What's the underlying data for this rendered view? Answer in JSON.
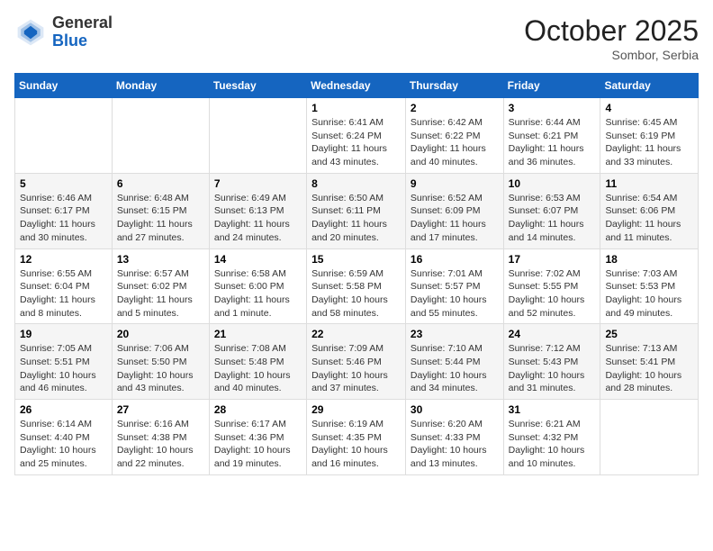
{
  "header": {
    "logo_general": "General",
    "logo_blue": "Blue",
    "month": "October 2025",
    "location": "Sombor, Serbia"
  },
  "weekdays": [
    "Sunday",
    "Monday",
    "Tuesday",
    "Wednesday",
    "Thursday",
    "Friday",
    "Saturday"
  ],
  "weeks": [
    [
      {
        "day": "",
        "info": ""
      },
      {
        "day": "",
        "info": ""
      },
      {
        "day": "",
        "info": ""
      },
      {
        "day": "1",
        "info": "Sunrise: 6:41 AM\nSunset: 6:24 PM\nDaylight: 11 hours\nand 43 minutes."
      },
      {
        "day": "2",
        "info": "Sunrise: 6:42 AM\nSunset: 6:22 PM\nDaylight: 11 hours\nand 40 minutes."
      },
      {
        "day": "3",
        "info": "Sunrise: 6:44 AM\nSunset: 6:21 PM\nDaylight: 11 hours\nand 36 minutes."
      },
      {
        "day": "4",
        "info": "Sunrise: 6:45 AM\nSunset: 6:19 PM\nDaylight: 11 hours\nand 33 minutes."
      }
    ],
    [
      {
        "day": "5",
        "info": "Sunrise: 6:46 AM\nSunset: 6:17 PM\nDaylight: 11 hours\nand 30 minutes."
      },
      {
        "day": "6",
        "info": "Sunrise: 6:48 AM\nSunset: 6:15 PM\nDaylight: 11 hours\nand 27 minutes."
      },
      {
        "day": "7",
        "info": "Sunrise: 6:49 AM\nSunset: 6:13 PM\nDaylight: 11 hours\nand 24 minutes."
      },
      {
        "day": "8",
        "info": "Sunrise: 6:50 AM\nSunset: 6:11 PM\nDaylight: 11 hours\nand 20 minutes."
      },
      {
        "day": "9",
        "info": "Sunrise: 6:52 AM\nSunset: 6:09 PM\nDaylight: 11 hours\nand 17 minutes."
      },
      {
        "day": "10",
        "info": "Sunrise: 6:53 AM\nSunset: 6:07 PM\nDaylight: 11 hours\nand 14 minutes."
      },
      {
        "day": "11",
        "info": "Sunrise: 6:54 AM\nSunset: 6:06 PM\nDaylight: 11 hours\nand 11 minutes."
      }
    ],
    [
      {
        "day": "12",
        "info": "Sunrise: 6:55 AM\nSunset: 6:04 PM\nDaylight: 11 hours\nand 8 minutes."
      },
      {
        "day": "13",
        "info": "Sunrise: 6:57 AM\nSunset: 6:02 PM\nDaylight: 11 hours\nand 5 minutes."
      },
      {
        "day": "14",
        "info": "Sunrise: 6:58 AM\nSunset: 6:00 PM\nDaylight: 11 hours\nand 1 minute."
      },
      {
        "day": "15",
        "info": "Sunrise: 6:59 AM\nSunset: 5:58 PM\nDaylight: 10 hours\nand 58 minutes."
      },
      {
        "day": "16",
        "info": "Sunrise: 7:01 AM\nSunset: 5:57 PM\nDaylight: 10 hours\nand 55 minutes."
      },
      {
        "day": "17",
        "info": "Sunrise: 7:02 AM\nSunset: 5:55 PM\nDaylight: 10 hours\nand 52 minutes."
      },
      {
        "day": "18",
        "info": "Sunrise: 7:03 AM\nSunset: 5:53 PM\nDaylight: 10 hours\nand 49 minutes."
      }
    ],
    [
      {
        "day": "19",
        "info": "Sunrise: 7:05 AM\nSunset: 5:51 PM\nDaylight: 10 hours\nand 46 minutes."
      },
      {
        "day": "20",
        "info": "Sunrise: 7:06 AM\nSunset: 5:50 PM\nDaylight: 10 hours\nand 43 minutes."
      },
      {
        "day": "21",
        "info": "Sunrise: 7:08 AM\nSunset: 5:48 PM\nDaylight: 10 hours\nand 40 minutes."
      },
      {
        "day": "22",
        "info": "Sunrise: 7:09 AM\nSunset: 5:46 PM\nDaylight: 10 hours\nand 37 minutes."
      },
      {
        "day": "23",
        "info": "Sunrise: 7:10 AM\nSunset: 5:44 PM\nDaylight: 10 hours\nand 34 minutes."
      },
      {
        "day": "24",
        "info": "Sunrise: 7:12 AM\nSunset: 5:43 PM\nDaylight: 10 hours\nand 31 minutes."
      },
      {
        "day": "25",
        "info": "Sunrise: 7:13 AM\nSunset: 5:41 PM\nDaylight: 10 hours\nand 28 minutes."
      }
    ],
    [
      {
        "day": "26",
        "info": "Sunrise: 6:14 AM\nSunset: 4:40 PM\nDaylight: 10 hours\nand 25 minutes."
      },
      {
        "day": "27",
        "info": "Sunrise: 6:16 AM\nSunset: 4:38 PM\nDaylight: 10 hours\nand 22 minutes."
      },
      {
        "day": "28",
        "info": "Sunrise: 6:17 AM\nSunset: 4:36 PM\nDaylight: 10 hours\nand 19 minutes."
      },
      {
        "day": "29",
        "info": "Sunrise: 6:19 AM\nSunset: 4:35 PM\nDaylight: 10 hours\nand 16 minutes."
      },
      {
        "day": "30",
        "info": "Sunrise: 6:20 AM\nSunset: 4:33 PM\nDaylight: 10 hours\nand 13 minutes."
      },
      {
        "day": "31",
        "info": "Sunrise: 6:21 AM\nSunset: 4:32 PM\nDaylight: 10 hours\nand 10 minutes."
      },
      {
        "day": "",
        "info": ""
      }
    ]
  ]
}
